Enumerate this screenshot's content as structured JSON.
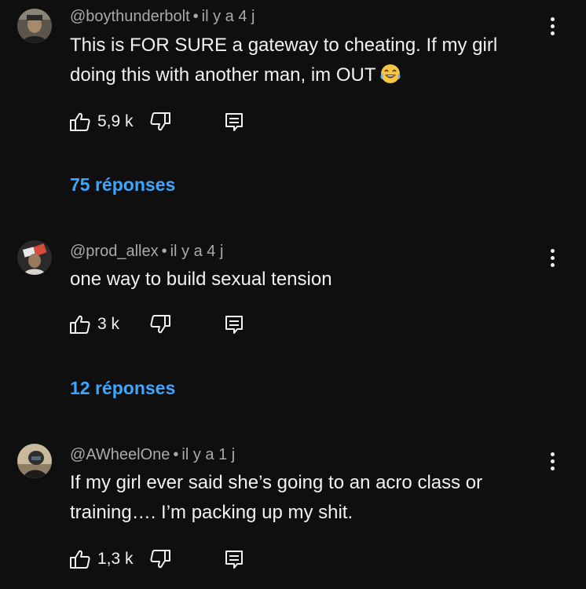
{
  "comments": [
    {
      "author": "@boythunderbolt",
      "separator": "•",
      "time": "il y a 4 j",
      "text": "This is FOR SURE a gateway to cheating. If my girl doing this with another man, im OUT",
      "emoji": "tears-of-joy-emoji",
      "likes": "5,9 k",
      "replies": "75 réponses",
      "avatar_color": "#6b6258"
    },
    {
      "author": "@prod_allex",
      "separator": "•",
      "time": "il y a 4 j",
      "text": "one way to build sexual tension",
      "likes": "3 k",
      "replies": "12 réponses",
      "avatar_color": "#3a3a3a"
    },
    {
      "author": "@AWheelOne",
      "separator": "•",
      "time": "il y a 1 j",
      "text": "If my girl ever said she’s going to an acro class or training…. I’m packing up my shit.",
      "likes": "1,3 k",
      "avatar_color": "#b8a88e"
    }
  ],
  "icons": {
    "like": "thumbs-up-icon",
    "dislike": "thumbs-down-icon",
    "reply": "reply-comment-icon",
    "more": "more-vertical-icon"
  },
  "colors": {
    "background": "#0f0f0f",
    "text": "#f1f1f1",
    "meta": "#aaaaaa",
    "link": "#3ea6ff"
  }
}
